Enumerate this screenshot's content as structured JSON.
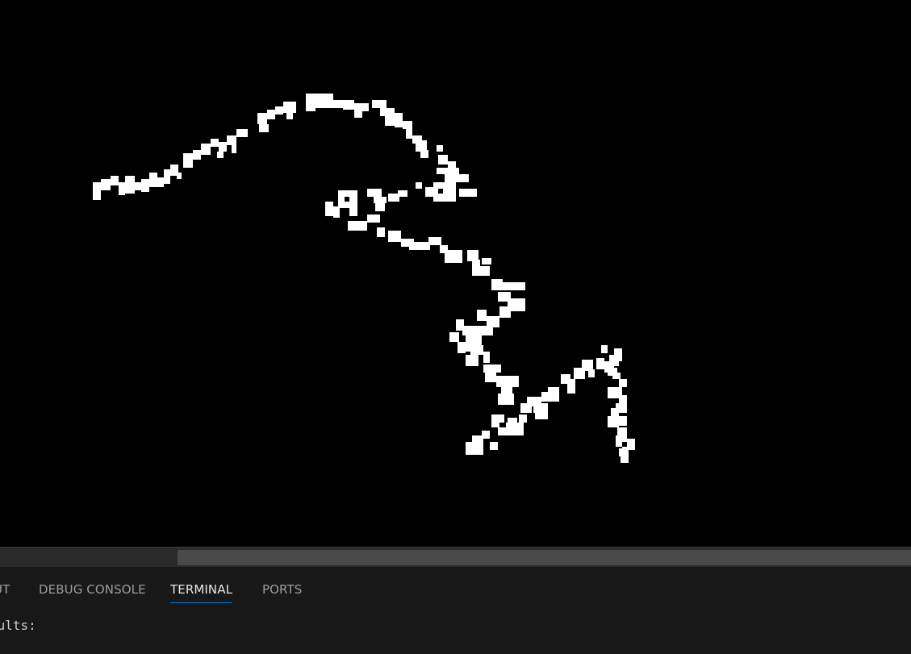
{
  "colors": {
    "canvas_bg": "#000000",
    "drawing": "#ffffff",
    "panel_bg": "#181818",
    "tab_text": "#9d9d9d",
    "tab_active_text": "#e7e7e7",
    "tab_active_underline": "#0078d4",
    "terminal_text": "#cccccc"
  },
  "panel": {
    "tabs": [
      {
        "label": "UT",
        "active": false
      },
      {
        "label": "DEBUG CONSOLE",
        "active": false
      },
      {
        "label": "TERMINAL",
        "active": true
      },
      {
        "label": "PORTS",
        "active": false
      }
    ],
    "terminal_text": "sults:"
  }
}
